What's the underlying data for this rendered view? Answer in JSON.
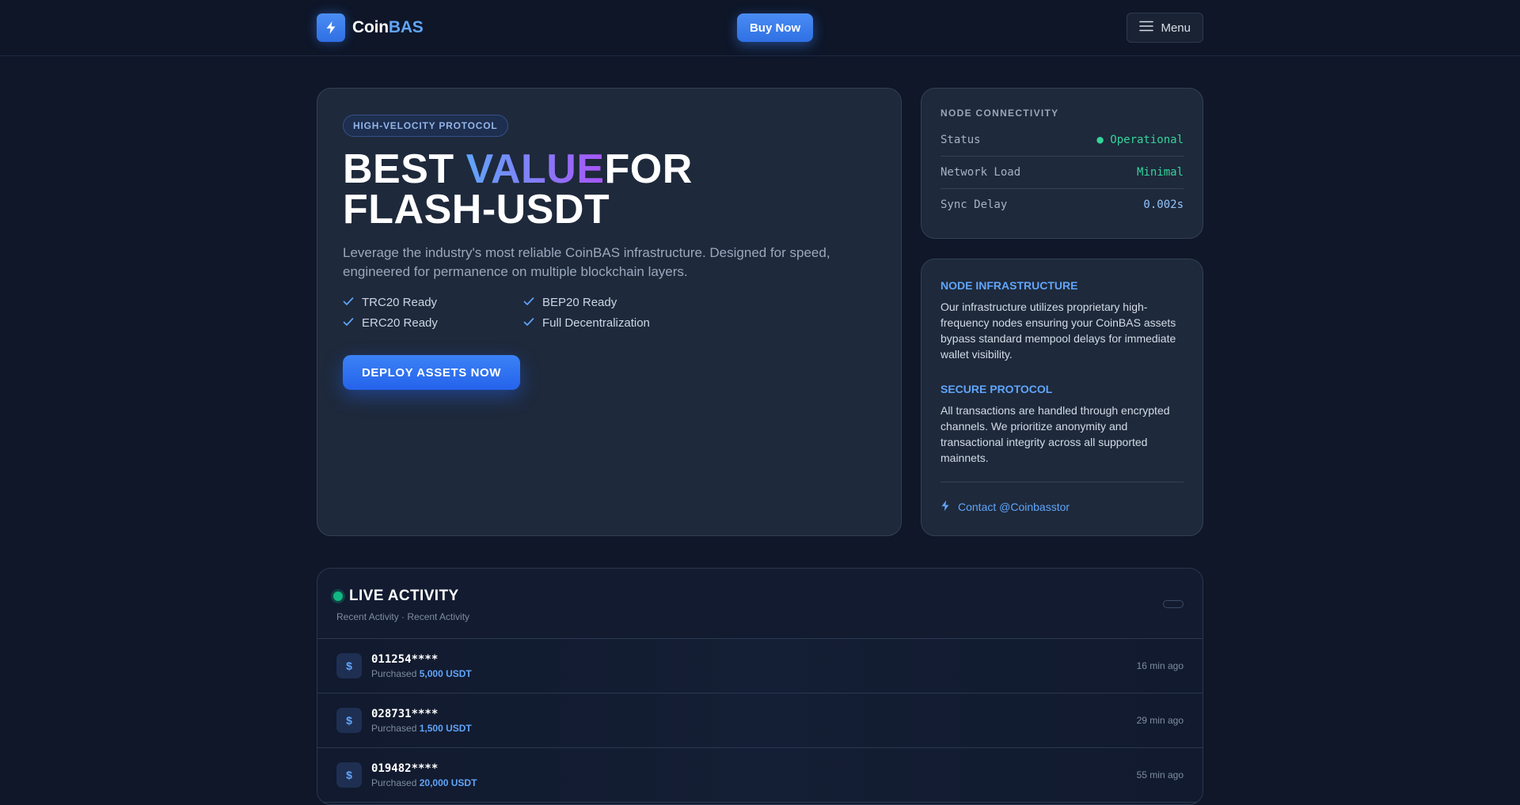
{
  "header": {
    "logo_main": "Coin",
    "logo_accent": "BAS",
    "buy_label": "Buy Now",
    "menu_label": "Menu"
  },
  "hero": {
    "badge": "HIGH-VELOCITY PROTOCOL",
    "title_start": "BEST ",
    "title_highlight": "VALUE",
    "title_end": "FOR FLASH-USDT",
    "description": "Leverage the industry's most reliable CoinBAS infrastructure. Designed for speed, engineered for permanence on multiple blockchain layers.",
    "features": [
      "TRC20 Ready",
      "BEP20 Ready",
      "ERC20 Ready",
      "Full Decentralization"
    ],
    "cta_label": "DEPLOY ASSETS NOW"
  },
  "connectivity": {
    "title": "NODE CONNECTIVITY",
    "rows": [
      {
        "key": "Status",
        "value": "● Operational"
      },
      {
        "key": "Network Load",
        "value": "Minimal"
      },
      {
        "key": "Sync Delay",
        "value": "0.002s"
      }
    ]
  },
  "infrastructure": {
    "h1": "NODE INFRASTRUCTURE",
    "p1": "Our infrastructure utilizes proprietary high-frequency nodes ensuring your CoinBAS assets bypass standard mempool delays for immediate wallet visibility.",
    "h2": "SECURE PROTOCOL",
    "p2": "All transactions are handled through encrypted channels. We prioritize anonymity and transactional integrity across all supported mainnets.",
    "contact": "Contact @Coinbasstor"
  },
  "activity": {
    "title": "LIVE ACTIVITY",
    "subtitle": "Recent Activity · Recent Activity",
    "coin_symbol": "$",
    "purchased_label": "Purchased",
    "rows": [
      {
        "id": "011254****",
        "amount": "5,000 USDT",
        "time": "16 min ago"
      },
      {
        "id": "028731****",
        "amount": "1,500 USDT",
        "time": "29 min ago"
      },
      {
        "id": "019482****",
        "amount": "20,000 USDT",
        "time": "55 min ago"
      }
    ]
  },
  "colors": {
    "accent": "#3b82f6",
    "accent_light": "#60a5fa",
    "success": "#34d399",
    "background": "#0f1729",
    "card": "#1e293b"
  }
}
